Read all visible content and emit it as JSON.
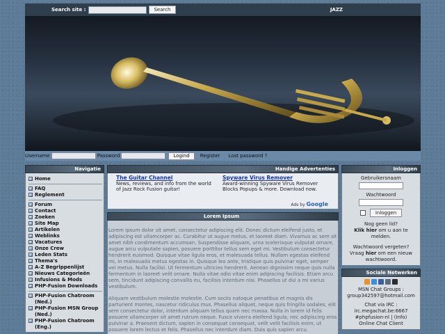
{
  "topbar": {
    "search_label": "Search site :",
    "search_button": "Search",
    "right_text": "JAZZ"
  },
  "loginbar": {
    "username_label": "Username",
    "password_label": "Password",
    "login_button": "Logind",
    "register_link": "Register",
    "lost_password_link": "Lost password ?"
  },
  "navigation": {
    "title": "Navigatie",
    "groups": [
      [
        "Home"
      ],
      [
        "FAQ",
        "Reglement"
      ],
      [
        "Forum",
        "Contact",
        "Zoeken",
        "Site Map",
        "Artikelen",
        "Weblinks",
        "Vacatures",
        "Onze Crew",
        "Leden Stats",
        "Thema's",
        "A-Z Begrippenlijst",
        "Nieuws Categorieën",
        "Infusions & Mods",
        "PHP-Fusion Downloads"
      ],
      [
        "PHP-Fusion Chatroom (Ned.)",
        "PHP-Fusion MSN Group (Ned.)",
        "PHP-Fusion Chatroom (Eng.)"
      ]
    ]
  },
  "ads": {
    "title": "Handige Advertenties",
    "items": [
      {
        "title": "The Guitar Channel",
        "text": "News, reviews, and info from the world of Jazz Rock Fusion guitar!"
      },
      {
        "title": "Spyware Virus Remover",
        "text": "Award-winning Spyware Virus Remover Blocks Popups & more. Download now."
      }
    ],
    "ads_by": "Ads by",
    "google": "Google"
  },
  "article": {
    "title": "Lorem Ipsum",
    "paragraphs": [
      "Lorem ipsum dolor sit amet, consectetur adipiscing elit. Donec dictum eleifend justo, et adipiscing est ullamcorper ac. Curabitur ut augue metus, et laoreet diam. Vivamus ac sem sit amet nibh condimentum accumsan. Suspendisse aliquam, urna scelerisque vulputat ornare, augue arcu vulputate sapien, posuere porttitor tellus sem eget mi. Vestibulum consectetur hendrerit euismod. Quisque vitae ligula eros, et malesuada tellus. Nullam egestas eleifend mi, in malesuada metus egestas in. Quisque leo ante, tristique quis pulvinar eget, semper vel metus. Nulla facilisi. Ut fermentum ultricies hendrerit. Aenean dignissim neque quis nulla fermentum in laoreet velit ornare. Nulla vitae odio vitae enim adipiscing facilisis. Etiam arcu sem, tincidunt adipiscing convallis eu, facilisis interdum nisi. Phasellus ut dui a mi varius vestibulum.",
      "Aliquam vestibulum molestie molestie. Cum sociis natoque penatibus et magnis dis parturient montes, nascetur ridiculus mus. Phasellus aliquet, neque quis fringilla sodales, elit sem consectetur dolor, interdum aliquam tellus quam nec massa. Nulla in lorem id felis posuere ullamcorper sit amet rutrum neque. Fusce viverra eleifend ligula, nec adipiscing eros pulvinar a. Praesent dictum, sapien in consequat consequat, velit velit facilisis enim, ut posuere lorem lectus et felis. Phasellus nec interdum diam. Duis quis sapien arcu."
    ]
  },
  "login": {
    "title": "Inloggen",
    "username_label": "Gebruikersnaam",
    "password_label": "Wachtwoord",
    "login_button": "Inloggen",
    "no_account": "Nog geen lid?",
    "click_here": "Klik hier",
    "register_text": "om u aan te melden.",
    "forgot": "Wachtwoord vergeten?",
    "ask_prefix": "Vraag",
    "here": "hier",
    "ask_suffix": "om een nieuw wachtwoord."
  },
  "social": {
    "title": "Sociale Netwerken",
    "msn_label": "MSN Chat Groups :",
    "msn_address": "group342597@hotmail.com",
    "irc_label": "Chat via IRC :",
    "irc_server": "irc.megachat.be:6667",
    "irc_channel": "#phpfusion-nl | (Info)",
    "online_client": "Online Chat Client",
    "icon_colors": [
      "#e8922b",
      "#3b8fd6",
      "#3b5fa0",
      "#5a6c7d",
      "#2c2c2c"
    ]
  }
}
